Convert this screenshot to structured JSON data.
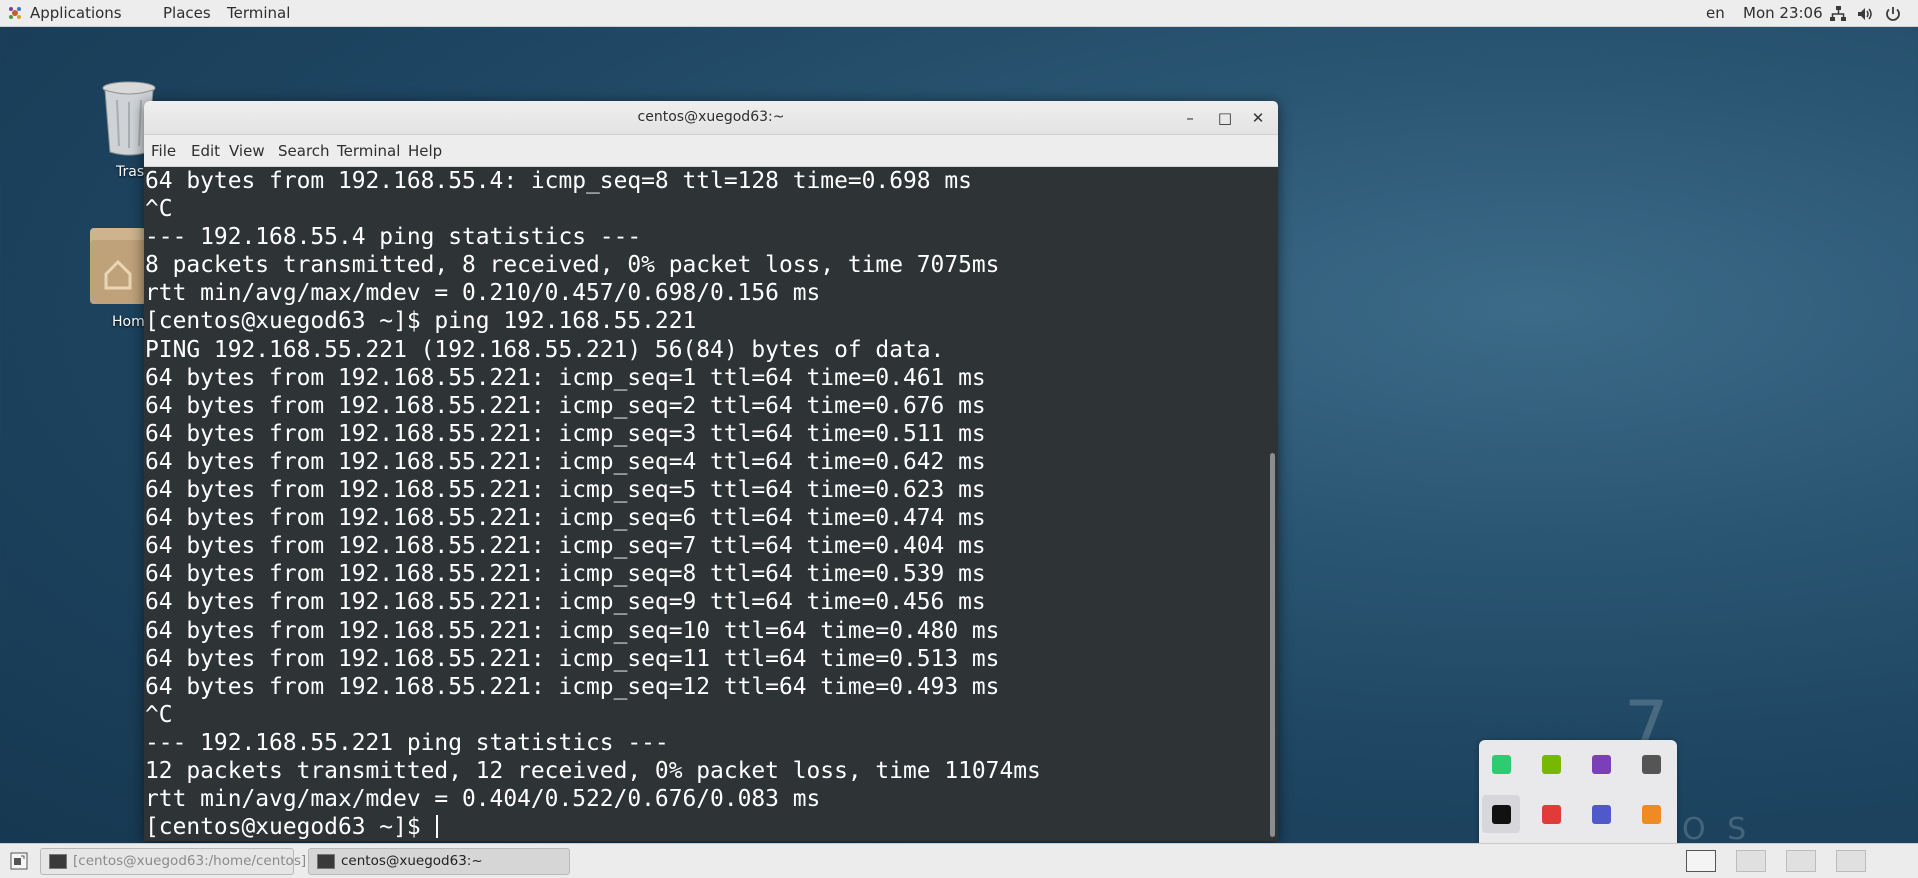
{
  "topbar": {
    "menus": [
      "Applications",
      "Places",
      "Terminal"
    ],
    "lang": "en",
    "clock": "Mon 23:06",
    "icons": [
      "network-icon",
      "volume-icon",
      "power-icon"
    ]
  },
  "desktop": {
    "icons": [
      {
        "label": "Tras",
        "icon": "trash-icon"
      },
      {
        "label": "Hom",
        "icon": "home-folder-icon"
      }
    ],
    "watermark_digit": "7",
    "watermark_text": "O S"
  },
  "window": {
    "title": "centos@xuegod63:~",
    "menu": [
      "File",
      "Edit",
      "View",
      "Search",
      "Terminal",
      "Help"
    ],
    "lines": [
      "64 bytes from 192.168.55.4: icmp_seq=8 ttl=128 time=0.698 ms",
      "^C",
      "--- 192.168.55.4 ping statistics ---",
      "8 packets transmitted, 8 received, 0% packet loss, time 7075ms",
      "rtt min/avg/max/mdev = 0.210/0.457/0.698/0.156 ms",
      "[centos@xuegod63 ~]$ ping 192.168.55.221",
      "PING 192.168.55.221 (192.168.55.221) 56(84) bytes of data.",
      "64 bytes from 192.168.55.221: icmp_seq=1 ttl=64 time=0.461 ms",
      "64 bytes from 192.168.55.221: icmp_seq=2 ttl=64 time=0.676 ms",
      "64 bytes from 192.168.55.221: icmp_seq=3 ttl=64 time=0.511 ms",
      "64 bytes from 192.168.55.221: icmp_seq=4 ttl=64 time=0.642 ms",
      "64 bytes from 192.168.55.221: icmp_seq=5 ttl=64 time=0.623 ms",
      "64 bytes from 192.168.55.221: icmp_seq=6 ttl=64 time=0.474 ms",
      "64 bytes from 192.168.55.221: icmp_seq=7 ttl=64 time=0.404 ms",
      "64 bytes from 192.168.55.221: icmp_seq=8 ttl=64 time=0.539 ms",
      "64 bytes from 192.168.55.221: icmp_seq=9 ttl=64 time=0.456 ms",
      "64 bytes from 192.168.55.221: icmp_seq=10 ttl=64 time=0.480 ms",
      "64 bytes from 192.168.55.221: icmp_seq=11 ttl=64 time=0.513 ms",
      "64 bytes from 192.168.55.221: icmp_seq=12 ttl=64 time=0.493 ms",
      "^C",
      "--- 192.168.55.221 ping statistics ---",
      "12 packets transmitted, 12 received, 0% packet loss, time 11074ms",
      "rtt min/avg/max/mdev = 0.404/0.522/0.676/0.083 ms",
      "[centos@xuegod63 ~]$ "
    ]
  },
  "taskbar": {
    "tasks": [
      {
        "label": "[centos@xuegod63:/home/centos]",
        "active": false
      },
      {
        "label": "centos@xuegod63:~",
        "active": true
      }
    ]
  },
  "tray": {
    "items": [
      "wechat-icon",
      "nvidia-icon",
      "onenote-icon",
      "onedrive-icon",
      "bookmark-app-icon",
      "red-app-icon",
      "teams-icon",
      "orange-app-icon",
      "defender-icon",
      "dark-app-icon"
    ],
    "colors": {
      "wechat-icon": "#2ecc71",
      "nvidia-icon": "#76b900",
      "onenote-icon": "#7b3fb8",
      "onedrive-icon": "#555555",
      "bookmark-app-icon": "#111111",
      "red-app-icon": "#e03a3a",
      "teams-icon": "#5059c9",
      "orange-app-icon": "#f08a24",
      "defender-icon": "#1f6fd8",
      "dark-app-icon": "#333333"
    }
  }
}
